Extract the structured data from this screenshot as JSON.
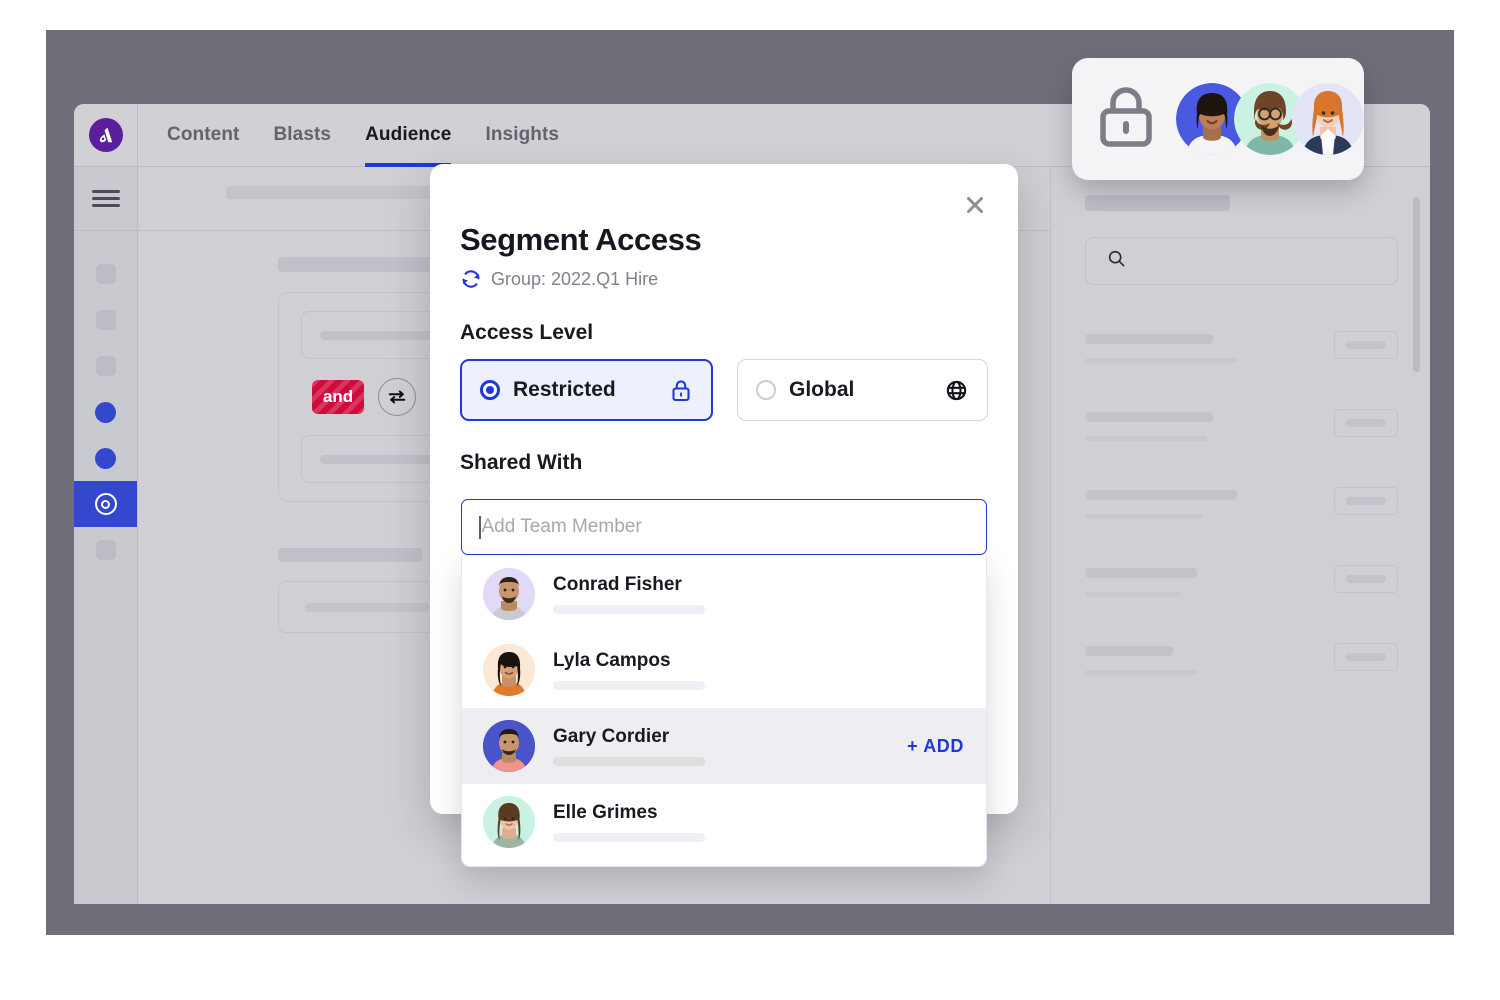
{
  "app": {
    "logo_name": "ascent-logo",
    "nav_tabs": [
      {
        "label": "Content",
        "active": false
      },
      {
        "label": "Blasts",
        "active": false
      },
      {
        "label": "Audience",
        "active": true
      },
      {
        "label": "Insights",
        "active": false
      }
    ],
    "builder": {
      "conjunction_label": "and"
    },
    "accent_blue": "#2137d6",
    "brand_purple": "#5b1f9e",
    "conjunction_red": "#cf0a3c"
  },
  "lock_card": {
    "lock_icon": "lock-icon",
    "avatars": [
      {
        "name": "avatar-1",
        "bg": "#4a5ae0"
      },
      {
        "name": "avatar-2",
        "bg": "#c9f2e3"
      },
      {
        "name": "avatar-3",
        "bg": "#e3e4f6"
      }
    ]
  },
  "modal": {
    "title": "Segment Access",
    "close_label": "✕",
    "sync_icon": "refresh-icon",
    "group_text": "Group: 2022.Q1 Hire",
    "access_level_heading": "Access Level",
    "levels": [
      {
        "label": "Restricted",
        "selected": true,
        "icon": "lock-icon"
      },
      {
        "label": "Global",
        "selected": false,
        "icon": "globe-icon"
      }
    ],
    "shared_with_heading": "Shared With",
    "input_placeholder": "Add Team Member",
    "input_value": "",
    "add_label": "+  ADD",
    "members": [
      {
        "name": "Conrad Fisher",
        "bg": "#e2d9f7",
        "highlighted": false,
        "add": false
      },
      {
        "name": "Lyla Campos",
        "bg": "#fbe9d5",
        "highlighted": false,
        "add": false
      },
      {
        "name": "Gary Cordier",
        "bg": "#4a53c8",
        "highlighted": true,
        "add": true
      },
      {
        "name": "Elle Grimes",
        "bg": "#c9f2e3",
        "highlighted": false,
        "add": false
      }
    ]
  },
  "right_panel": {
    "search_icon": "search-icon",
    "rows": [
      {
        "w1": 128,
        "w2": 152
      },
      {
        "w1": 128,
        "w2": 122
      },
      {
        "w1": 152,
        "w2": 118
      },
      {
        "w1": 112,
        "w2": 96
      },
      {
        "w1": 88,
        "w2": 112
      }
    ]
  }
}
